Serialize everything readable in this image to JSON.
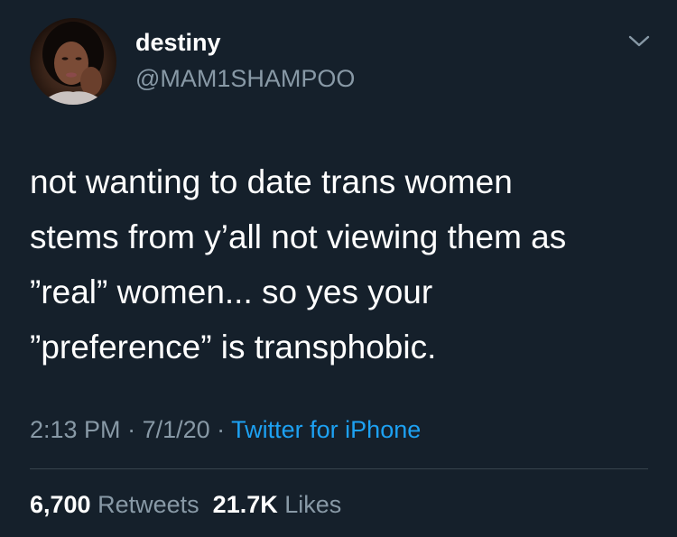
{
  "author": {
    "display_name": "destiny",
    "handle": "@MAM1SHAMPOO",
    "avatar_icon": "profile-photo"
  },
  "menu": {
    "icon": "chevron-down-icon",
    "color": "#8899a6"
  },
  "tweet": {
    "lines": [
      "not wanting to date trans women",
      "stems from y’all not viewing them as",
      "”real” women... so yes your",
      "”preference” is transphobic."
    ]
  },
  "meta": {
    "time": "2:13 PM",
    "sep1": " · ",
    "date": "7/1/20",
    "sep2": " · ",
    "source": "Twitter for iPhone"
  },
  "stats": {
    "retweets_count": "6,700",
    "retweets_label": "Retweets",
    "likes_count": "21.7K",
    "likes_label": "Likes"
  },
  "colors": {
    "background": "#15202b",
    "text_primary": "#ffffff",
    "text_secondary": "#8899a6",
    "link": "#1da1f2",
    "divider": "#38444d"
  }
}
